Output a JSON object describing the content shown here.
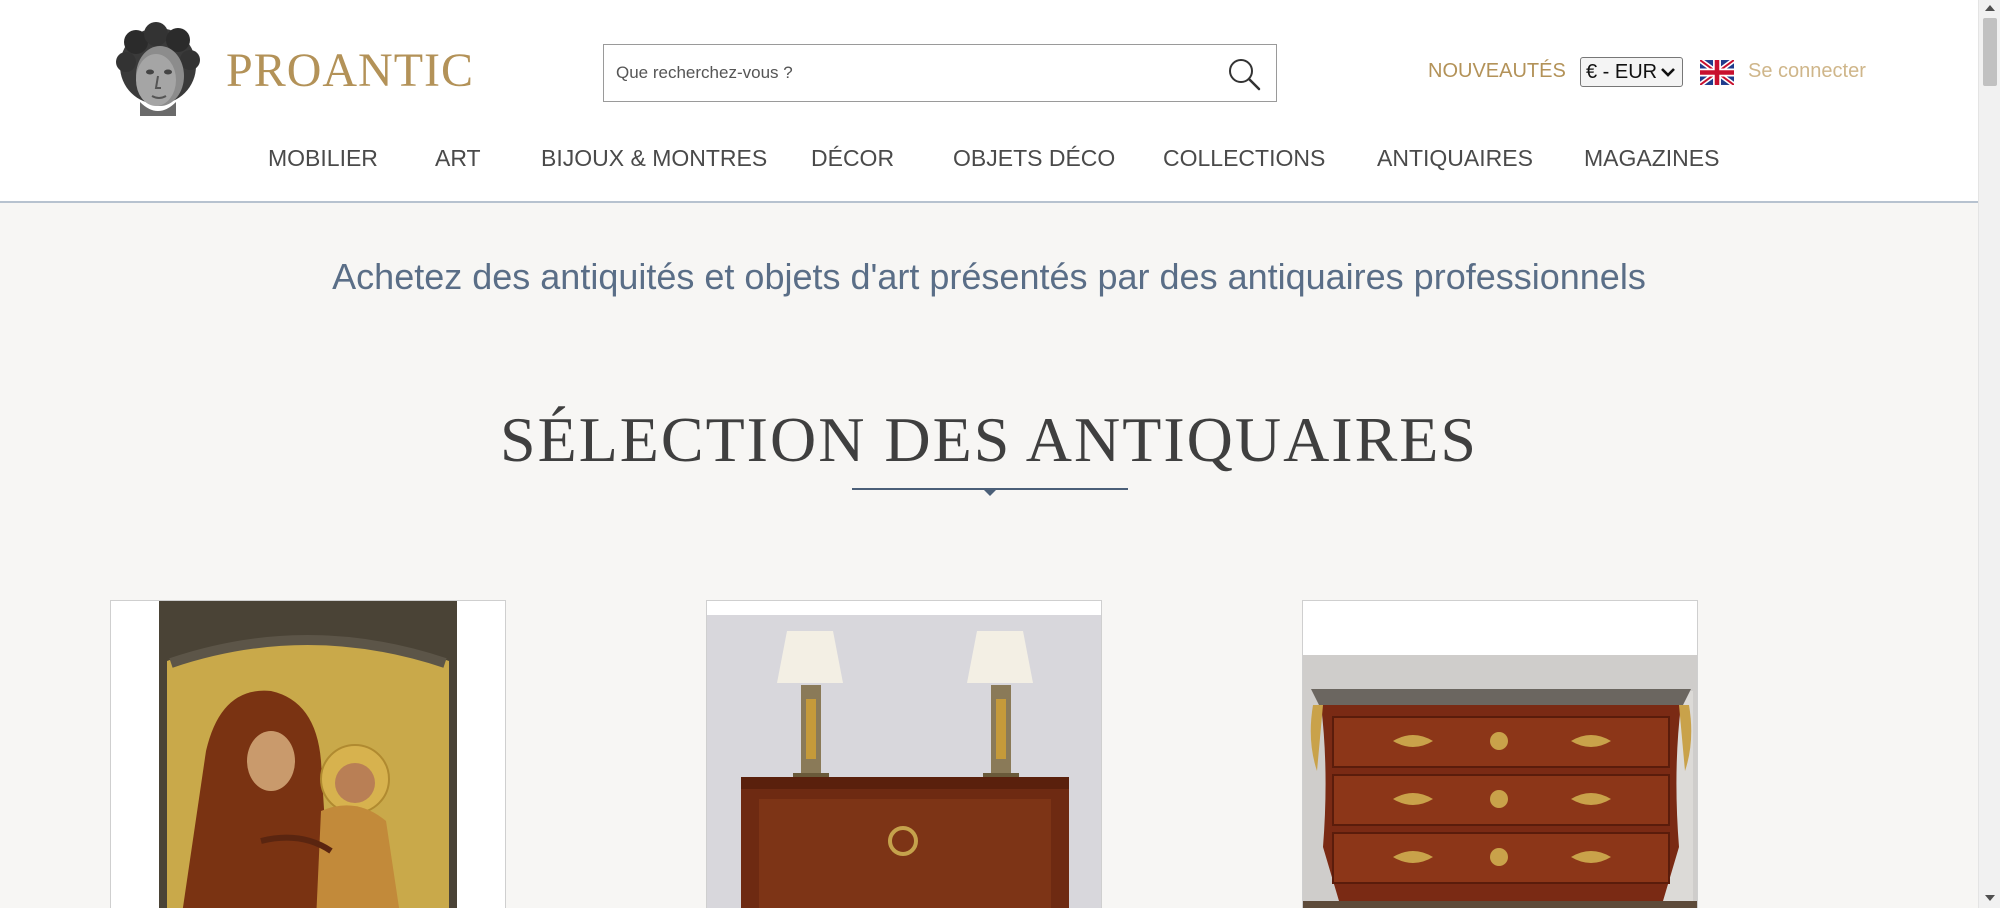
{
  "header": {
    "logo_text": "PROANTIC",
    "search_placeholder": "Que recherchez-vous ?",
    "nouveautes": "NOUVEAUTÉS",
    "currency": "€ - EUR",
    "language_flag": "uk-flag-icon",
    "login": "Se connecter"
  },
  "nav": {
    "items": [
      {
        "label": "MOBILIER"
      },
      {
        "label": "ART"
      },
      {
        "label": "BIJOUX & MONTRES"
      },
      {
        "label": "DÉCOR"
      },
      {
        "label": "OBJETS DÉCO"
      },
      {
        "label": "COLLECTIONS"
      },
      {
        "label": "ANTIQUAIRES"
      },
      {
        "label": "MAGAZINES"
      }
    ]
  },
  "main": {
    "tagline": "Achetez des antiquités et objets d'art présentés par des antiquaires professionnels",
    "section_title": "SÉLECTION DES ANTIQUAIRES"
  },
  "colors": {
    "brand_gold": "#b39258",
    "login_gold": "#cfb68a",
    "tagline_blue": "#5a6e87",
    "rule_blue": "#4b5f78",
    "page_background": "#f7f6f4"
  }
}
